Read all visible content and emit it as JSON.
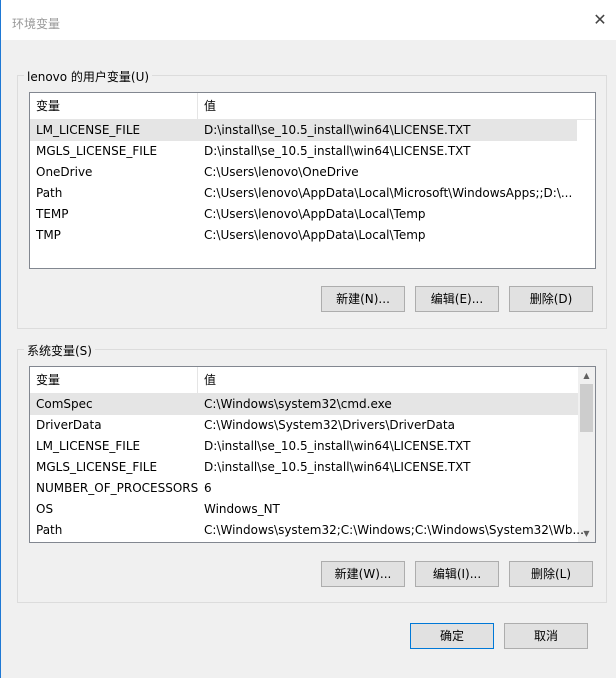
{
  "window": {
    "title": "环境变量",
    "close_glyph": "✕"
  },
  "user_group": {
    "label": "lenovo 的用户变量(U)",
    "headers": [
      "变量",
      "值"
    ],
    "rows": [
      [
        "LM_LICENSE_FILE",
        "D:\\install\\se_10.5_install\\win64\\LICENSE.TXT"
      ],
      [
        "MGLS_LICENSE_FILE",
        "D:\\install\\se_10.5_install\\win64\\LICENSE.TXT"
      ],
      [
        "OneDrive",
        "C:\\Users\\lenovo\\OneDrive"
      ],
      [
        "Path",
        "C:\\Users\\lenovo\\AppData\\Local\\Microsoft\\WindowsApps;;D:\\..."
      ],
      [
        "TEMP",
        "C:\\Users\\lenovo\\AppData\\Local\\Temp"
      ],
      [
        "TMP",
        "C:\\Users\\lenovo\\AppData\\Local\\Temp"
      ]
    ],
    "selected_index": 0,
    "buttons": {
      "new": "新建(N)...",
      "edit": "编辑(E)...",
      "delete": "删除(D)"
    }
  },
  "system_group": {
    "label": "系统变量(S)",
    "headers": [
      "变量",
      "值"
    ],
    "rows": [
      [
        "ComSpec",
        "C:\\Windows\\system32\\cmd.exe"
      ],
      [
        "DriverData",
        "C:\\Windows\\System32\\Drivers\\DriverData"
      ],
      [
        "LM_LICENSE_FILE",
        "D:\\install\\se_10.5_install\\win64\\LICENSE.TXT"
      ],
      [
        "MGLS_LICENSE_FILE",
        "D:\\install\\se_10.5_install\\win64\\LICENSE.TXT"
      ],
      [
        "NUMBER_OF_PROCESSORS",
        "6"
      ],
      [
        "OS",
        "Windows_NT"
      ],
      [
        "Path",
        "C:\\Windows\\system32;C:\\Windows;C:\\Windows\\System32\\Wb..."
      ]
    ],
    "selected_index": 0,
    "buttons": {
      "new": "新建(W)...",
      "edit": "编辑(I)...",
      "delete": "删除(L)"
    }
  },
  "dialog_buttons": {
    "ok": "确定",
    "cancel": "取消"
  },
  "colors": {
    "accent": "#0078d7",
    "selection": "#e5e5e5",
    "window_bg": "#f0f0f0"
  },
  "icons": {
    "scroll_up": "▲",
    "scroll_down": "▼"
  }
}
